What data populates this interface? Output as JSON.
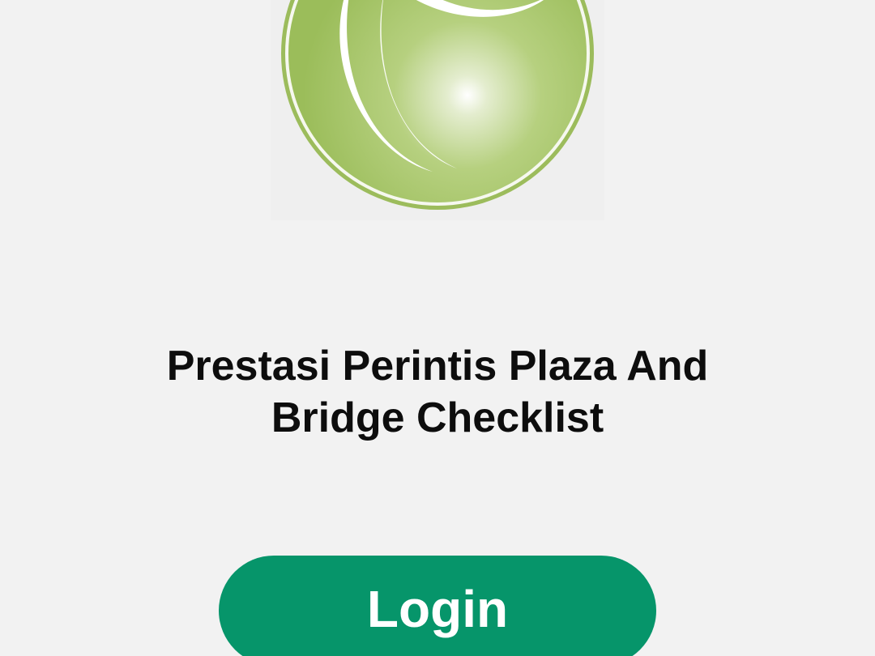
{
  "app": {
    "title": "Prestasi Perintis Plaza And Bridge Checklist"
  },
  "logo": {
    "icon": "company-logo-icon",
    "primary_color": "#9cbc5c",
    "highlight_color": "#ffffff"
  },
  "login": {
    "label": "Login",
    "color": "#06956a"
  }
}
